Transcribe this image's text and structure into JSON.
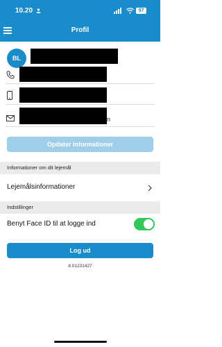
{
  "status_bar": {
    "time": "10.20",
    "battery": "97"
  },
  "header": {
    "title": "Profil"
  },
  "profile": {
    "initials": "BL",
    "email_suffix": "n"
  },
  "buttons": {
    "update": "Opdater informationer",
    "logout": "Log ud"
  },
  "lease_section": {
    "header": "Informationer om dit lejemål",
    "item": "Lejemålsinformationer"
  },
  "settings_section": {
    "header": "Indstillinger",
    "faceid_label": "Benyt Face ID til at logge ind",
    "faceid_enabled": true
  },
  "version": "8.01231427",
  "colors": {
    "accent": "#1a8ccb",
    "accent_disabled": "#9fcfe8",
    "toggle_on": "#34c759"
  }
}
